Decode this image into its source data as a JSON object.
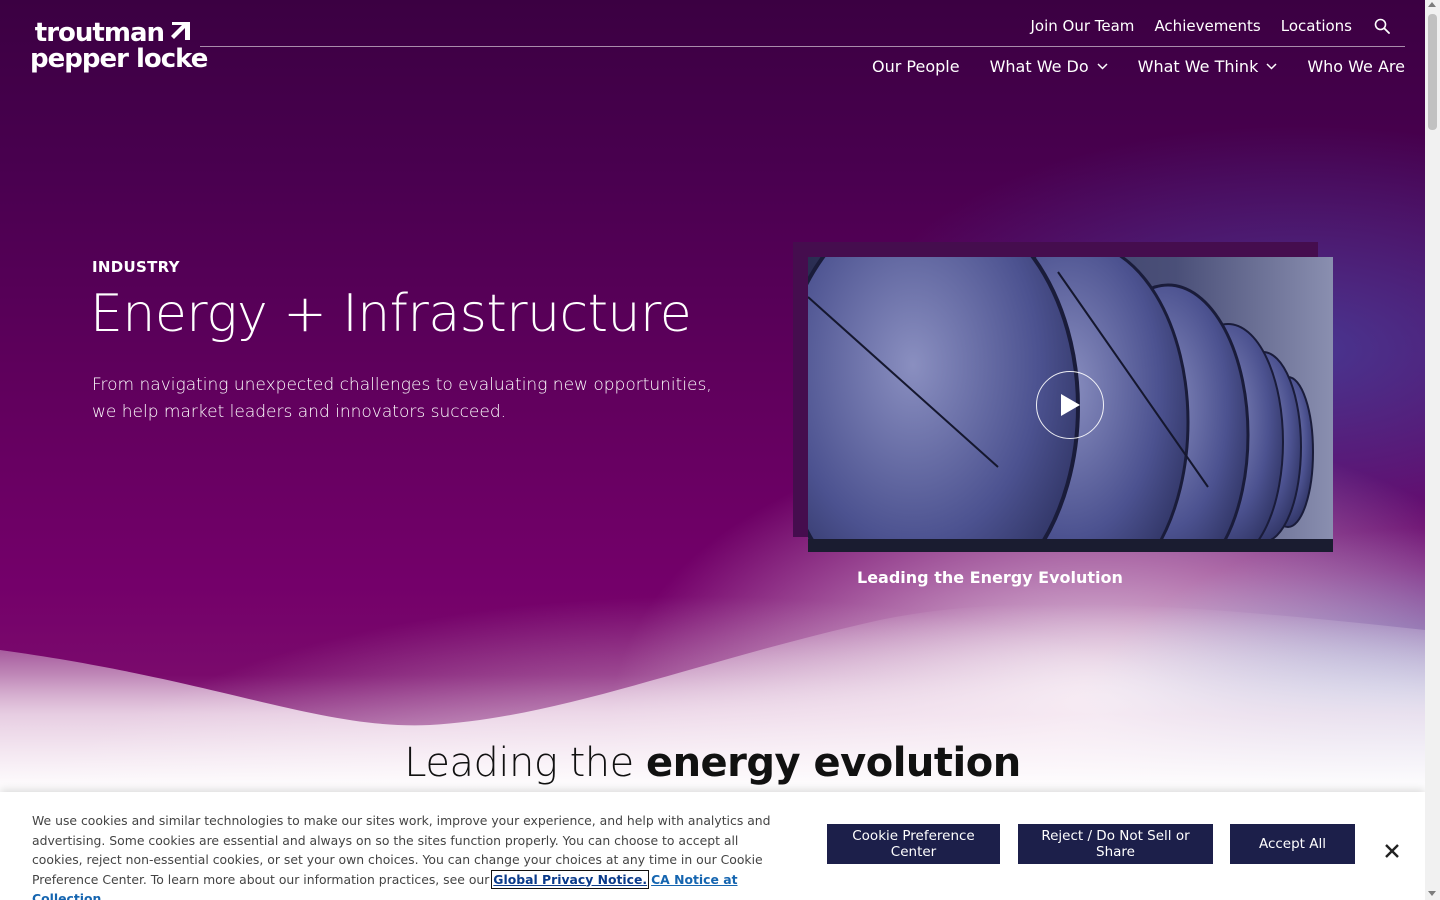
{
  "header": {
    "logo_line1": "troutman",
    "logo_line2": "pepper locke",
    "utility_nav": [
      "Join Our Team",
      "Achievements",
      "Locations"
    ],
    "main_nav": [
      {
        "label": "Our People",
        "dropdown": false
      },
      {
        "label": "What We Do",
        "dropdown": true
      },
      {
        "label": "What We Think",
        "dropdown": true
      },
      {
        "label": "Who We Are",
        "dropdown": false
      }
    ],
    "search_icon": "search-icon"
  },
  "hero": {
    "eyebrow": "INDUSTRY",
    "title": "Energy + Infrastructure",
    "description": "From navigating unexpected challenges to evaluating new opportunities, we help market leaders and innovators succeed.",
    "video_caption": "Leading the Energy Evolution"
  },
  "section": {
    "heading_light": "Leading the ",
    "heading_bold": "energy evolution"
  },
  "cookie_banner": {
    "text": "We use cookies and similar technologies to make our sites work, improve your experience, and help with analytics and advertising. Some cookies are essential and always on so the sites function properly. You can choose to accept all cookies, reject non-essential cookies, or set your own choices. You can change your choices at any time in our Cookie Preference Center. To learn more about our information practices, see our ",
    "privacy_link": "Global Privacy Notice.",
    "ca_link": "CA Notice at Collection.",
    "buttons": {
      "preference": "Cookie Preference Center",
      "reject": "Reject / Do Not Sell or Share",
      "accept": "Accept All"
    }
  },
  "colors": {
    "hero_dark": "#3b0042",
    "hero_magenta": "#74006a",
    "button_navy": "#1c1f4a",
    "link_blue": "#1565b0"
  }
}
